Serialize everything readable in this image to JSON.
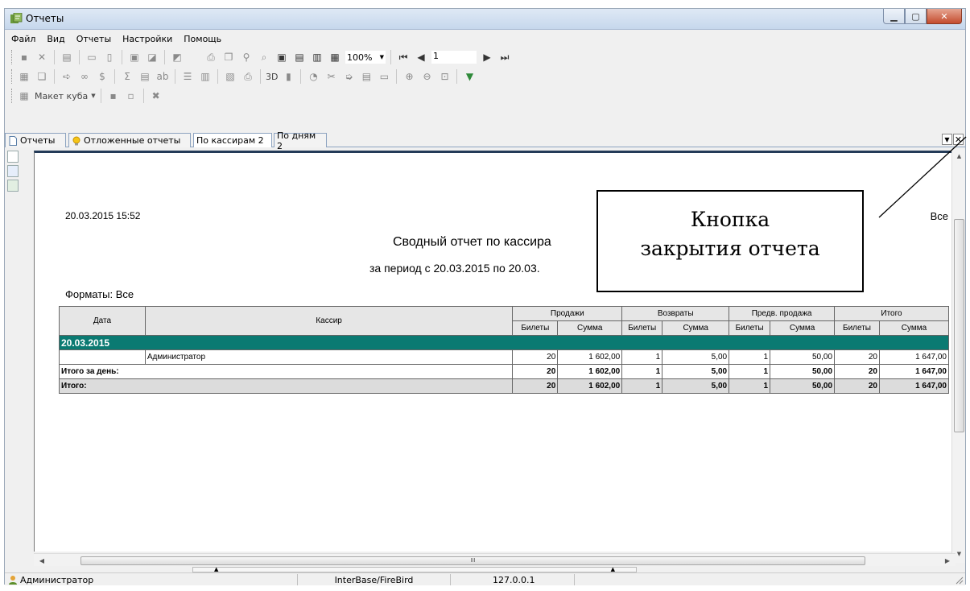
{
  "window": {
    "title": "Отчеты"
  },
  "menu": [
    "Файл",
    "Вид",
    "Отчеты",
    "Настройки",
    "Помощь"
  ],
  "toolbar": {
    "zoom": "100%",
    "page": "1",
    "cube_label": "Макет куба",
    "label_3d": "3D"
  },
  "tabs": [
    {
      "label": "Отчеты",
      "icon": "document-icon"
    },
    {
      "label": "Отложенные отчеты",
      "icon": "lightbulb-icon"
    },
    {
      "label": "По кассирам 2",
      "icon": ""
    },
    {
      "label": "По дням 2",
      "icon": ""
    }
  ],
  "report": {
    "date": "20.03.2015 15:52",
    "title": "Сводный отчет по кассира",
    "period": "за период с 20.03.2015 по 20.03.",
    "formats": "Форматы: Все",
    "all": "Все",
    "headers": {
      "date": "Дата",
      "cashier": "Кассир",
      "sales": "Продажи",
      "returns": "Возвраты",
      "presale": "Предв. продажа",
      "total": "Итого",
      "tickets": "Билеты",
      "sum": "Сумма"
    },
    "group": "20.03.2015",
    "rows": [
      {
        "date": "",
        "cashier": "Администратор",
        "values": [
          "20",
          "1 602,00",
          "1",
          "5,00",
          "1",
          "50,00",
          "20",
          "1 647,00"
        ]
      }
    ],
    "day_total": {
      "label": "Итого за день:",
      "values": [
        "20",
        "1 602,00",
        "1",
        "5,00",
        "1",
        "50,00",
        "20",
        "1 647,00"
      ]
    },
    "grand_total": {
      "label": "Итого:",
      "values": [
        "20",
        "1 602,00",
        "1",
        "5,00",
        "1",
        "50,00",
        "20",
        "1 647,00"
      ]
    }
  },
  "callout": {
    "line1": "Кнопка",
    "line2": "закрытия отчета"
  },
  "status": {
    "user": "Администратор",
    "db": "InterBase/FireBird",
    "host": "127.0.0.1"
  },
  "hscroll_mark": "III",
  "colors": {
    "group_row": "#0a7a72",
    "header_bar": "#243b58"
  }
}
